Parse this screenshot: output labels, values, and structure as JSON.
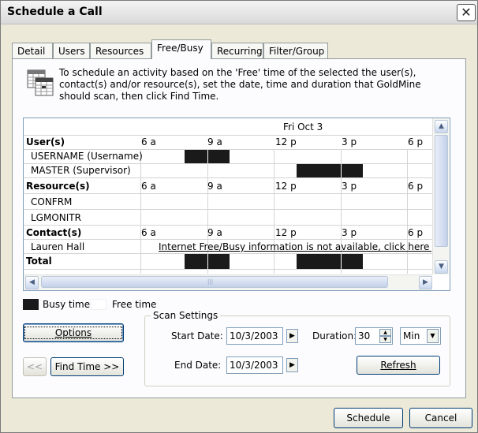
{
  "window": {
    "title": "Schedule a Call",
    "close_glyph": "✕"
  },
  "tabs": [
    {
      "label": "Detail",
      "active": false
    },
    {
      "label": "Users",
      "active": false
    },
    {
      "label": "Resources",
      "active": false
    },
    {
      "label": "Free/Busy",
      "active": true
    },
    {
      "label": "Recurring",
      "active": false
    },
    {
      "label": "Filter/Group",
      "active": false
    }
  ],
  "instructions": "To schedule an activity based on the 'Free' time of the selected the user(s), contact(s) and/or resource(s), set the date, time and duration that GoldMine should scan, then click Find Time.",
  "grid": {
    "date_header": "Fri Oct 3",
    "time_labels": [
      "6 a",
      "9 a",
      "12 p",
      "3 p",
      "6 p"
    ],
    "users_header": "User(s)",
    "users": [
      "USERNAME (Username)",
      "MASTER (Supervisor)"
    ],
    "resources_header": "Resource(s)",
    "resources": [
      "CONFRM",
      "LGMONITR"
    ],
    "contacts_header": "Contact(s)",
    "contacts": [
      "Lauren Hall"
    ],
    "contact_message": "Internet Free/Busy information is not available, click here for he",
    "total_label": "Total"
  },
  "legend": {
    "busy_label": "Busy time",
    "free_label": "Free time",
    "busy_color": "#1a1a1a",
    "free_color": "#ffffff"
  },
  "buttons": {
    "options": "Options",
    "prev": "<<",
    "find_time": "Find Time >>",
    "refresh": "Refresh",
    "schedule": "Schedule",
    "cancel": "Cancel"
  },
  "scan_settings": {
    "title": "Scan Settings",
    "start_date_label": "Start Date:",
    "start_date_value": "10/3/2003",
    "end_date_label": "End Date:",
    "end_date_value": "10/3/2003",
    "duration_label": "Duration:",
    "duration_value": "30",
    "duration_unit": "Min"
  },
  "icons": {
    "calendar": "calendar-grid-icon",
    "arrow_right": "▶",
    "spin_up": "▲",
    "spin_down": "▼",
    "dropdown": "▼",
    "scroll_up": "▲",
    "scroll_down": "▼",
    "scroll_left": "◀",
    "scroll_right": "▶"
  }
}
